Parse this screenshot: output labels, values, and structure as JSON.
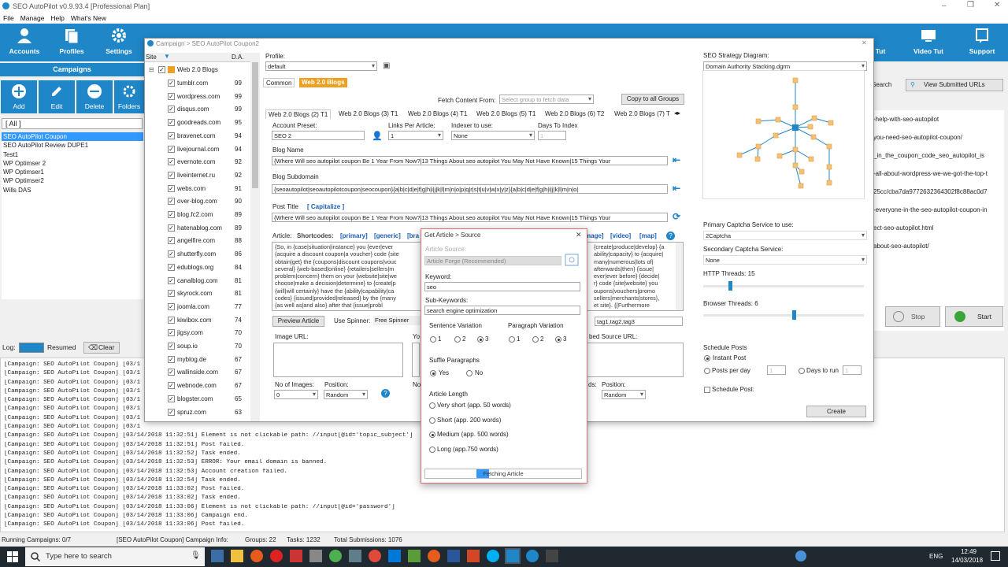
{
  "app": {
    "title": "SEO AutoPilot v0.9.93.4  [Professional Plan]",
    "menu": [
      "File",
      "Manage",
      "Help",
      "What's New"
    ],
    "toolbar": [
      "Accounts",
      "Profiles",
      "Settings",
      "Tut",
      "Video Tut",
      "Support"
    ]
  },
  "campaigns": {
    "header": "Campaigns",
    "tools": [
      "Add",
      "Edit",
      "Delete",
      "Folders"
    ],
    "filter": "[ All ]",
    "items": [
      "SEO AutoPilot Coupon",
      "SEO AutoPilot Review DUPE1",
      "Test1",
      "WP Optimser 2",
      "WP Optimser1",
      "WP Optimser2",
      "Wills DAS"
    ]
  },
  "bg_right": {
    "search_label": "Search",
    "view_submitted": "View Submitted URLs",
    "rows": [
      "-help-with-seo-autopilot",
      "you-need-seo-autopilot-coupon/",
      "_in_the_coupon_code_seo_autopilot_is",
      "-all-about-wordpress-we-we-got-the-top-t",
      "25cc/cba7da9772632364302f8c88ac0d7",
      "-everyone-in-the-seo-autopilot-coupon-in",
      "ect-seo-autopilot.html",
      "about-seo-autopilot/"
    ],
    "stop_label": "Stop",
    "start_label": "Start"
  },
  "log": {
    "label": "Log:",
    "resumed": "Resumed",
    "clear": "Clear",
    "lines": [
      "[Campaign: SEO AutoPilot Coupon] [03/1",
      "[Campaign: SEO AutoPilot Coupon] [03/1",
      "[Campaign: SEO AutoPilot Coupon] [03/1",
      "[Campaign: SEO AutoPilot Coupon] [03/1",
      "[Campaign: SEO AutoPilot Coupon] [03/1",
      "[Campaign: SEO AutoPilot Coupon] [03/1",
      "[Campaign: SEO AutoPilot Coupon] [03/1",
      "[Campaign: SEO AutoPilot Coupon] [03/1",
      "[Campaign: SEO AutoPilot Coupon] [03/14/2018 11:32:51] Element is not clickable path: //input[@id='topic_subject']",
      "[Campaign: SEO AutoPilot Coupon] [03/14/2018 11:32:51] Post failed.",
      "[Campaign: SEO AutoPilot Coupon] [03/14/2018 11:32:52] Task ended.",
      "[Campaign: SEO AutoPilot Coupon] [03/14/2018 11:32:53] ERROR: Your email domain is banned.",
      "[Campaign: SEO AutoPilot Coupon] [03/14/2018 11:32:53] Account creation failed.",
      "[Campaign: SEO AutoPilot Coupon] [03/14/2018 11:32:54] Task ended.",
      "[Campaign: SEO AutoPilot Coupon] [03/14/2018 11:33:02] Post failed.",
      "[Campaign: SEO AutoPilot Coupon] [03/14/2018 11:33:02] Task ended.",
      "[Campaign: SEO AutoPilot Coupon] [03/14/2018 11:33:06] Element is not clickable path: //input[@id='password']",
      "[Campaign: SEO AutoPilot Coupon] [03/14/2018 11:33:06] Campaign end.",
      "[Campaign: SEO AutoPilot Coupon] [03/14/2018 11:33:06] Post failed."
    ]
  },
  "status": {
    "running": "Running Campaigns: 0/7",
    "info": "[SEO AutoPilot Coupon] Campaign Info:",
    "groups": "Groups: 22",
    "tasks": "Tasks: 1232",
    "submissions": "Total Submissions: 1076"
  },
  "taskbar": {
    "search_placeholder": "Type here to search",
    "lang": "ENG",
    "time": "12:49",
    "date": "14/03/2018"
  },
  "campaign_dialog": {
    "title": "Campaign > SEO AutoPilot Coupon2",
    "site_header": "Site",
    "da_header": "D.A.",
    "group_label": "Web 2.0 Blogs",
    "sites": [
      {
        "name": "tumblr.com",
        "da": "99"
      },
      {
        "name": "wordpress.com",
        "da": "99"
      },
      {
        "name": "disqus.com",
        "da": "99"
      },
      {
        "name": "goodreads.com",
        "da": "95"
      },
      {
        "name": "bravenet.com",
        "da": "94"
      },
      {
        "name": "livejournal.com",
        "da": "94"
      },
      {
        "name": "evernote.com",
        "da": "92"
      },
      {
        "name": "liveinternet.ru",
        "da": "92"
      },
      {
        "name": "webs.com",
        "da": "91"
      },
      {
        "name": "over-blog.com",
        "da": "90"
      },
      {
        "name": "blog.fc2.com",
        "da": "89"
      },
      {
        "name": "hatenablog.com",
        "da": "89"
      },
      {
        "name": "angelfire.com",
        "da": "88"
      },
      {
        "name": "shutterfly.com",
        "da": "86"
      },
      {
        "name": "edublogs.org",
        "da": "84"
      },
      {
        "name": "canalblog.com",
        "da": "81"
      },
      {
        "name": "skyrock.com",
        "da": "81"
      },
      {
        "name": "joomla.com",
        "da": "77"
      },
      {
        "name": "kiwibox.com",
        "da": "74"
      },
      {
        "name": "jigsy.com",
        "da": "70"
      },
      {
        "name": "soup.io",
        "da": "70"
      },
      {
        "name": "myblog.de",
        "da": "67"
      },
      {
        "name": "wallinside.com",
        "da": "67"
      },
      {
        "name": "webnode.com",
        "da": "67"
      },
      {
        "name": "blogster.com",
        "da": "65"
      },
      {
        "name": "spruz.com",
        "da": "63"
      }
    ],
    "profile_label": "Profile:",
    "profile_value": "default",
    "top_tabs": [
      "Common",
      "Web 2.0 Blogs"
    ],
    "fetch_label": "Fetch Content From:",
    "fetch_placeholder": "Select group to fetch data",
    "copy_all": "Copy to all Groups",
    "sub_tabs": [
      "Web 2.0 Blogs (2) T1",
      "Web 2.0 Blogs (3) T1",
      "Web 2.0 Blogs (4) T1",
      "Web 2.0 Blogs (5) T1",
      "Web 2.0 Blogs (6) T2",
      "Web 2.0 Blogs (7) T"
    ],
    "account_preset_label": "Account Preset:",
    "account_preset_value": "SEO 2",
    "links_label": "Links Per Article:",
    "links_value": "1",
    "indexer_label": "Indexer to use:",
    "indexer_value": "None",
    "days_label": "Days To Index",
    "days_value": "1",
    "blog_name_label": "Blog Name",
    "blog_name_value": "{Where Will seo autopilot coupon Be 1 Year From Now?|13 Things About seo autopilot You May Not Have Known|15 Things Your",
    "blog_sub_label": "Blog Subdomain",
    "blog_sub_value": "{seoautopilot|seoautopilotcoupon|seocoupon}{a|b|c|d|e|f|g|h|i|j|k|l|m|n|o|p|q|r|s|t|u|v|w|x|y|z}{a|b|c|d|e|f|g|h|i|j|k|l|m|n|o|",
    "post_title_label": "Post Title",
    "capitalize": "[ Capitalize ]",
    "post_title_value": "{Where Will seo autopilot coupon Be 1 Year From Now?|13 Things About seo autopilot You May Not Have Known|15 Things Your",
    "article_label": "Article:",
    "shortcodes_label": "Shortcodes:",
    "shortcodes": [
      "[primary]",
      "[generic]",
      "[bra"
    ],
    "shortcodes_right": [
      "mage]",
      "[video]",
      "[map]"
    ],
    "article_left": [
      "{So, in {case|situation|instance} you {ever|ever",
      "{acquire a discount coupon|a voucher} code {site",
      "obtain|get} the {coupons|discount coupons|vouc",
      "several} {web-based|online} {retailers|sellers|m",
      "problem|concern} them on your {website|site|we",
      "choose|make a decision|determine} to {create|p",
      "{will|will certainly} have the {ability|capability|ca",
      "codes} {issued|provided|released} by the {many",
      "{as well as|and also} after that {issue|probl"
    ],
    "article_right": [
      "{create|produce|develop} {a",
      "ability|capacity} to {acquire|",
      "many|numerous|lots of|",
      "afterwards|then} {issue|",
      "ever|ever before} {decide|",
      "r} code {site|website} you",
      "oupons|vouchers|promo",
      "sellers|merchants|stores},",
      "et site}. {{Furthermore"
    ],
    "preview_article": "Preview Article",
    "use_spinner": "Use Spinner:",
    "spinner_value": "Free Spinner",
    "tags_value": "tag1,tag2,tag3",
    "image_url_label": "Image URL:",
    "embed_label": "bed Source URL:",
    "no_images_label": "No of Images:",
    "no_images_value": "0",
    "position_label": "Position:",
    "position_value": "Random",
    "position2_label": "Position:",
    "position2_value": "Random",
    "strategy_label": "SEO Strategy Diagram:",
    "strategy_value": "Domain Authority Stacking.dgrm",
    "captcha_label": "Primary Captcha Service to use:",
    "captcha_value": "2Captcha",
    "secondary_captcha_label": "Secondary Captcha Service:",
    "secondary_captcha_value": "None",
    "http_threads": "HTTP Threads: 15",
    "browser_threads": "Browser Threads: 6",
    "schedule_label": "Schedule Posts",
    "instant_post": "Instant Post",
    "posts_per_day": "Posts per day",
    "days_to_run": "Days to run",
    "posts_per_day_value": "1",
    "days_to_run_value": "1",
    "schedule_post": "Schedule Post:",
    "create": "Create"
  },
  "article_dialog": {
    "title": "Get Article > Source",
    "source_label": "Article Source:",
    "source_value": "Article Forge (Recommended)",
    "keyword_label": "Keyword:",
    "keyword_value": "seo",
    "subkeywords_label": "Sub-Keywords:",
    "subkeywords_value": "search engine optimization",
    "sentence_label": "Sentence Variation",
    "paragraph_label": "Paragraph Variation",
    "variation_options": [
      "1",
      "2",
      "3"
    ],
    "shuffle_label": "Suffle Paragraphs",
    "yes": "Yes",
    "no": "No",
    "length_label": "Article Length",
    "lengths": [
      "Very short (app. 50 words)",
      "Short (app. 200 words)",
      "Medium (app. 500 words)",
      "Long (app.750 words)"
    ],
    "progress_label": "Fetching Article",
    "progress_value": 0.08
  }
}
